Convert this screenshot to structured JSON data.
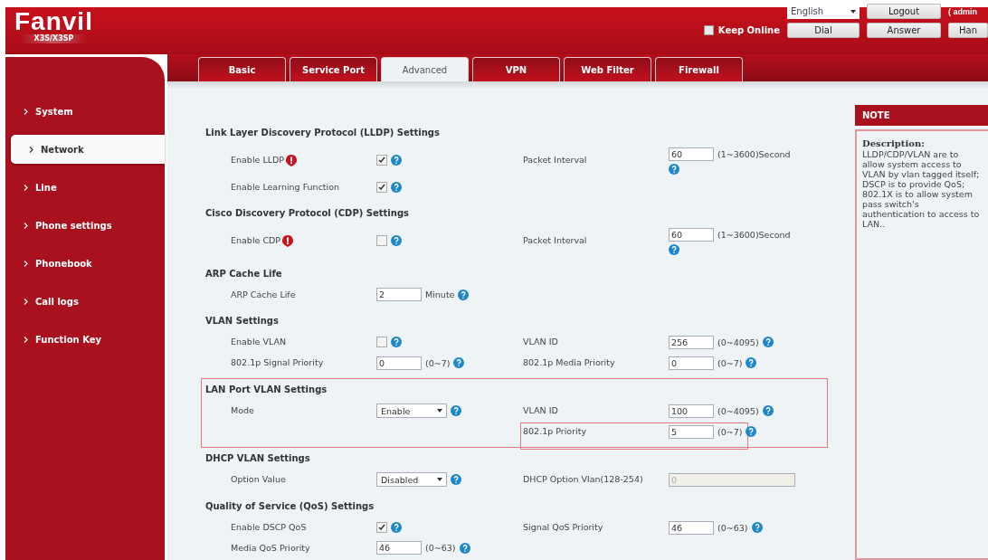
{
  "logo": {
    "name": "Fanvil",
    "model": "X3S/X3SP"
  },
  "header": {
    "language": "English",
    "keep_online": {
      "label": "Keep Online",
      "checked": false
    },
    "user": "( admin",
    "buttons_top": [
      "Logout"
    ],
    "buttons_bottom": [
      "Dial",
      "Answer",
      "Han"
    ]
  },
  "sidebar": {
    "items": [
      {
        "label": "System",
        "selected": false
      },
      {
        "label": "Network",
        "selected": true
      },
      {
        "label": "Line",
        "selected": false
      },
      {
        "label": "Phone settings",
        "selected": false
      },
      {
        "label": "Phonebook",
        "selected": false
      },
      {
        "label": "Call logs",
        "selected": false
      },
      {
        "label": "Function Key",
        "selected": false
      }
    ]
  },
  "tabs": [
    {
      "label": "Basic",
      "selected": false
    },
    {
      "label": "Service Port",
      "selected": false
    },
    {
      "label": "Advanced",
      "selected": true
    },
    {
      "label": "VPN",
      "selected": false
    },
    {
      "label": "Web Filter",
      "selected": false
    },
    {
      "label": "Firewall",
      "selected": false
    }
  ],
  "sections": [
    {
      "title": "Link Layer Discovery Protocol (LLDP) Settings",
      "highlighted": false,
      "rows": [
        {
          "left": {
            "label": "Enable LLDP",
            "alert": true,
            "kind": "checkbox",
            "checked": true
          },
          "right": {
            "label": "Packet Interval",
            "kind": "text",
            "value": "60",
            "unit": "(1~3600)Second",
            "help_below": true,
            "highlighted": false
          }
        },
        {
          "left": {
            "label": "Enable Learning Function",
            "alert": false,
            "kind": "checkbox",
            "checked": true
          }
        }
      ]
    },
    {
      "title": "Cisco Discovery Protocol (CDP) Settings",
      "highlighted": false,
      "rows": [
        {
          "left": {
            "label": "Enable CDP",
            "alert": true,
            "kind": "checkbox",
            "checked": false
          },
          "right": {
            "label": "Packet Interval",
            "kind": "text",
            "value": "60",
            "unit": "(1~3600)Second",
            "help_below": true,
            "highlighted": false
          }
        }
      ]
    },
    {
      "title": "ARP Cache Life",
      "highlighted": false,
      "rows": [
        {
          "left": {
            "label": "ARP Cache Life",
            "alert": false,
            "kind": "text",
            "value": "2",
            "unit": "Minute",
            "help_below": false
          }
        }
      ]
    },
    {
      "title": "VLAN Settings",
      "highlighted": false,
      "rows": [
        {
          "left": {
            "label": "Enable VLAN",
            "alert": false,
            "kind": "checkbox",
            "checked": false
          },
          "right": {
            "label": "VLAN ID",
            "kind": "text",
            "value": "256",
            "unit": "(0~4095)",
            "help_below": false,
            "highlighted": false
          }
        },
        {
          "left": {
            "label": "802.1p Signal Priority",
            "alert": false,
            "kind": "text",
            "value": "0",
            "unit": "(0~7)",
            "help_below": false
          },
          "right": {
            "label": "802.1p Media Priority",
            "kind": "text",
            "value": "0",
            "unit": "(0~7)",
            "help_below": false,
            "highlighted": false
          }
        }
      ]
    },
    {
      "title": "LAN Port VLAN Settings",
      "highlighted": true,
      "rows": [
        {
          "left": {
            "label": "Mode",
            "alert": false,
            "kind": "select",
            "value": "Enable"
          },
          "right": {
            "label": "VLAN ID",
            "kind": "text",
            "value": "100",
            "unit": "(0~4095)",
            "help_below": false,
            "highlighted": false
          }
        },
        {
          "right": {
            "label": "802.1p Priority",
            "kind": "text",
            "value": "5",
            "unit": "(0~7)",
            "help_below": false,
            "highlighted": true
          }
        }
      ]
    },
    {
      "title": "DHCP VLAN Settings",
      "highlighted": false,
      "rows": [
        {
          "left": {
            "label": "Option Value",
            "alert": false,
            "kind": "select",
            "value": "Disabled"
          },
          "right": {
            "label": "DHCP Option Vlan(128-254)",
            "kind": "readonly",
            "value": "0",
            "highlighted": false
          }
        }
      ]
    },
    {
      "title": "Quality of Service (QoS) Settings",
      "highlighted": false,
      "rows": [
        {
          "left": {
            "label": "Enable DSCP QoS",
            "alert": false,
            "kind": "checkbox",
            "checked": true
          },
          "right": {
            "label": "Signal QoS Priority",
            "kind": "text",
            "value": "46",
            "unit": "(0~63)",
            "help_below": false,
            "highlighted": false
          }
        },
        {
          "left": {
            "label": "Media QoS Priority",
            "alert": false,
            "kind": "text",
            "value": "46",
            "unit": "(0~63)",
            "help_below": false
          }
        }
      ]
    }
  ],
  "note": {
    "title": "NOTE",
    "heading": "Description:",
    "text": "LLDP/CDP/VLAN are to allow system access to VLAN by vlan tagged itself; DSCP is to provide QoS; 802.1X is to allow system pass switch's authentication to access to LAN.."
  }
}
